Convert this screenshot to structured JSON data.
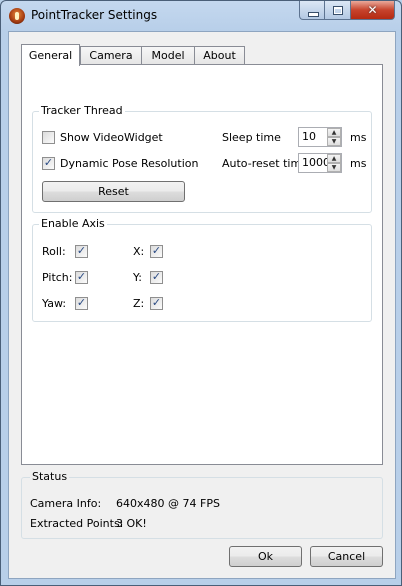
{
  "window": {
    "title": "PointTracker Settings",
    "min_glyph": "",
    "max_glyph": "",
    "close_glyph": "✕"
  },
  "tabs": [
    {
      "label": "General",
      "active": true
    },
    {
      "label": "Camera",
      "active": false
    },
    {
      "label": "Model",
      "active": false
    },
    {
      "label": "About",
      "active": false
    }
  ],
  "tracker_thread": {
    "title": "Tracker Thread",
    "show_video_widget": {
      "label": "Show VideoWidget",
      "checked": false
    },
    "dynamic_pose": {
      "label": "Dynamic Pose Resolution",
      "checked": true
    },
    "sleep_time": {
      "label": "Sleep time",
      "value": "10",
      "unit": "ms"
    },
    "auto_reset": {
      "label": "Auto-reset time",
      "value": "1000",
      "unit": "ms"
    },
    "reset_label": "Reset"
  },
  "enable_axis": {
    "title": "Enable Axis",
    "roll": {
      "label": "Roll:",
      "checked": true
    },
    "pitch": {
      "label": "Pitch:",
      "checked": true
    },
    "yaw": {
      "label": "Yaw:",
      "checked": true
    },
    "x": {
      "label": "X:",
      "checked": true
    },
    "y": {
      "label": "Y:",
      "checked": true
    },
    "z": {
      "label": "Z:",
      "checked": true
    }
  },
  "status": {
    "title": "Status",
    "camera_info_label": "Camera Info:",
    "camera_info_value": "640x480 @ 74 FPS",
    "extracted_points_label": "Extracted Points:",
    "extracted_points_value": "3 OK!"
  },
  "buttons": {
    "ok": "Ok",
    "cancel": "Cancel"
  },
  "icons": {
    "app": "pointtracker-app-icon",
    "check": "✓",
    "spin_up": "▲",
    "spin_down": "▼"
  }
}
